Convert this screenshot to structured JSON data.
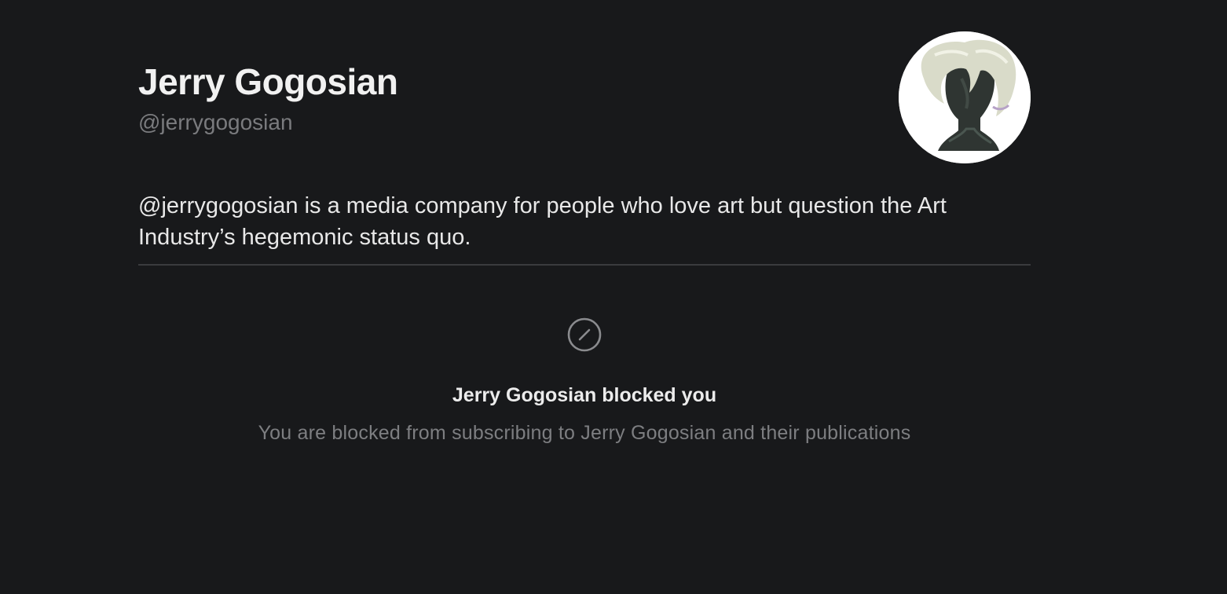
{
  "profile": {
    "name": "Jerry Gogosian",
    "handle": "@jerrygogosian",
    "bio": "@jerrygogosian is a media company for people who love art but question the Art Industry’s hegemonic status quo.",
    "avatar_icon": "avatar-bust-with-wig"
  },
  "blocked": {
    "icon": "blocked-circle-icon",
    "title": "Jerry Gogosian blocked you",
    "message": "You are blocked from subscribing to Jerry Gogosian and their publications"
  },
  "colors": {
    "background": "#18191b",
    "primary_text": "#f1f1f1",
    "secondary_text": "#7a7b7e",
    "divider": "#3a3b3e"
  }
}
